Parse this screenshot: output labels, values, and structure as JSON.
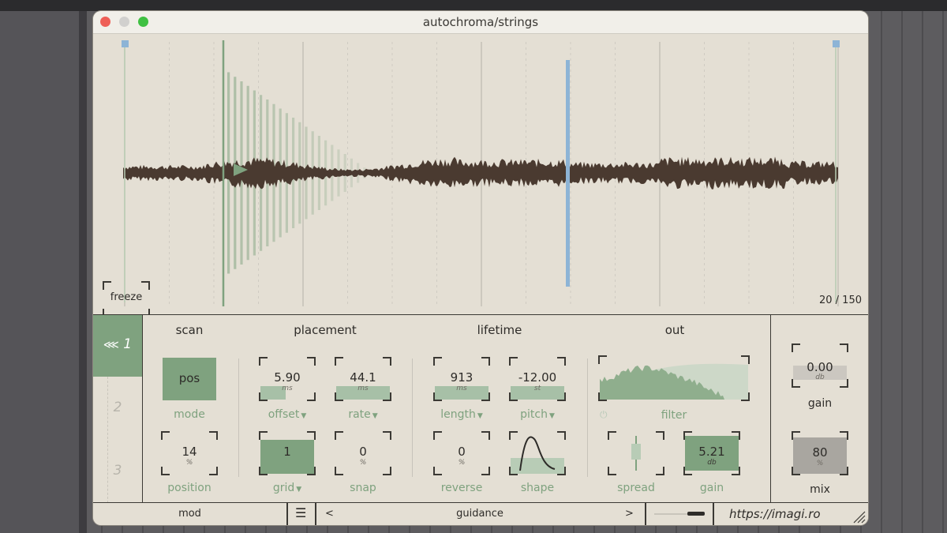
{
  "window": {
    "title": "autochroma/strings"
  },
  "waveform": {
    "freeze_label": "freeze",
    "counter": "20 / 150",
    "playhead_color": "#8db4d6",
    "grain_color": "#7fa27f",
    "wave_color": "#4a3a30"
  },
  "tabs": [
    {
      "label": "1",
      "icon": "modulation-icon",
      "active": true
    },
    {
      "label": "2",
      "active": false
    },
    {
      "label": "3",
      "active": false
    }
  ],
  "sections": {
    "scan": "scan",
    "placement": "placement",
    "lifetime": "lifetime",
    "out": "out"
  },
  "controls": {
    "mode": {
      "value": "pos",
      "label": "mode"
    },
    "position": {
      "value": "14",
      "unit": "%",
      "label": "position"
    },
    "offset": {
      "value": "5.90",
      "unit": "ms",
      "label": "offset"
    },
    "rate": {
      "value": "44.1",
      "unit": "ms",
      "label": "rate"
    },
    "grid": {
      "value": "1",
      "label": "grid"
    },
    "snap": {
      "value": "0",
      "unit": "%",
      "label": "snap"
    },
    "length": {
      "value": "913",
      "unit": "ms",
      "label": "length"
    },
    "pitch": {
      "value": "-12.00",
      "unit": "st",
      "label": "pitch"
    },
    "reverse": {
      "value": "0",
      "unit": "%",
      "label": "reverse"
    },
    "shape": {
      "label": "shape"
    },
    "filter": {
      "label": "filter"
    },
    "spread": {
      "label": "spread"
    },
    "out_gain": {
      "value": "5.21",
      "unit": "db",
      "label": "gain"
    },
    "master_gain": {
      "value": "0.00",
      "unit": "db",
      "label": "gain"
    },
    "mix": {
      "value": "80",
      "unit": "%",
      "label": "mix"
    }
  },
  "bottom": {
    "mod": "mod",
    "prev": "<",
    "guidance": "guidance",
    "next": ">",
    "url": "https://imagi.ro"
  }
}
